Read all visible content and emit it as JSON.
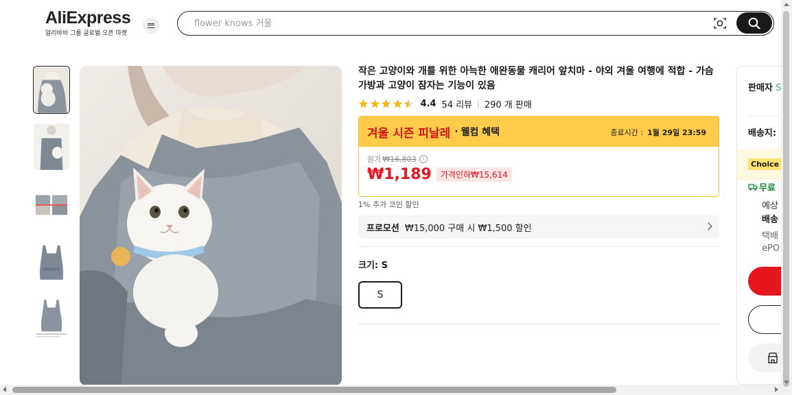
{
  "header": {
    "logo_text": "AliExpress",
    "logo_subtitle": "알리바바 그룹 글로벌 오픈 마켓",
    "menu_icon": "hamburger-menu-icon",
    "search_placeholder": "flower knows 거울",
    "camera_icon": "camera-search-icon",
    "search_icon": "search-icon"
  },
  "gallery": {
    "thumbnails": [
      "cat-apron-front",
      "apron-with-cat",
      "product-details",
      "apron-gray",
      "apron-blueprint"
    ],
    "active_index": 0
  },
  "product": {
    "title": "작은 고양이와 개를 위한 아늑한 애완동물 캐리어 앞치마 - 야외 겨울 여행에 적합 - 가슴 가방과 고양이 잠자는 기능이 있음",
    "rating": "4.4",
    "rating_stars": 4.5,
    "reviews": "54 리뷰",
    "sold": "290 개 판매",
    "promo_name": "겨울 시즌 피날레",
    "promo_dot": "·",
    "promo_sub": "웰컴 혜택",
    "promo_end_label": "종료시간 :",
    "promo_end_time": "1월 29일 23:59",
    "orig_label": "원가",
    "orig_price": "₩16,803",
    "price": "₩1,189",
    "discount": "가격인하₩15,614",
    "coin": "1% 추가 코인 할인",
    "promotion_label": "프로모션",
    "promotion_text": "₩15,000 구매 시 ₩1,500 할인",
    "size_label": "크기: S",
    "size_option": "S"
  },
  "side": {
    "seller": "판매자",
    "seller_extra": "S",
    "ship_to": "배송지:",
    "choice": "Choice",
    "free": "무료",
    "estimated": "예상",
    "delivery": "배송",
    "courier": "택배",
    "epost": "ePO",
    "store_icon": "store-icon"
  },
  "colors": {
    "accent_red": "#e5161e",
    "promo_yellow": "#ffcb48"
  }
}
